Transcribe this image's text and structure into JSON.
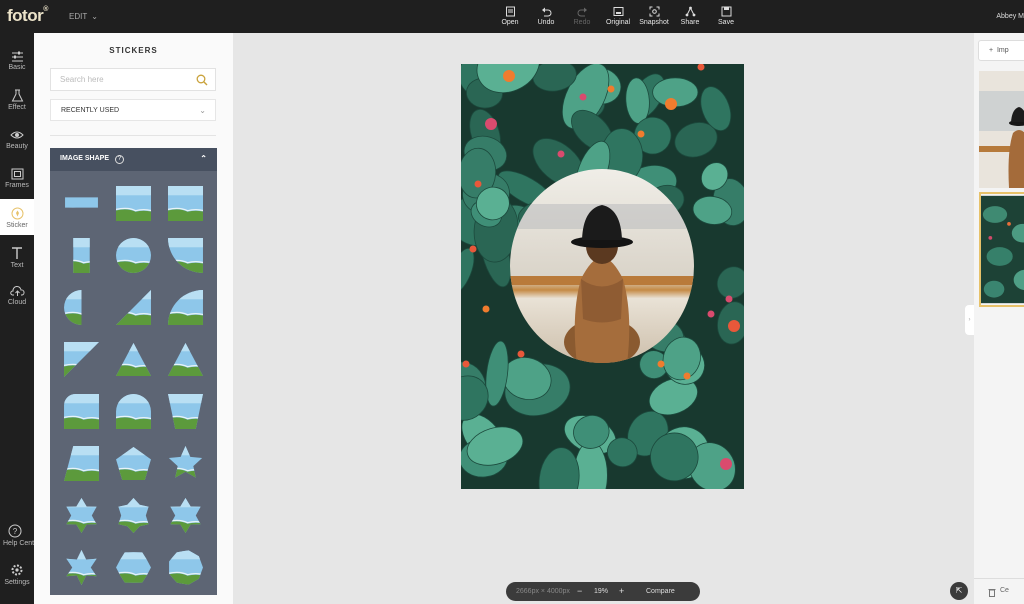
{
  "app": {
    "logo": "fotor",
    "mode": "EDIT",
    "user": "Abbey M"
  },
  "toolbar": [
    {
      "label": "Open",
      "icon": "open-icon"
    },
    {
      "label": "Undo",
      "icon": "undo-icon"
    },
    {
      "label": "Redo",
      "icon": "redo-icon"
    },
    {
      "label": "Original",
      "icon": "original-icon"
    },
    {
      "label": "Snapshot",
      "icon": "snapshot-icon"
    },
    {
      "label": "Share",
      "icon": "share-icon"
    },
    {
      "label": "Save",
      "icon": "save-icon"
    }
  ],
  "nav": {
    "basic": "Basic",
    "effect": "Effect",
    "beauty": "Beauty",
    "frames": "Frames",
    "sticker": "Sticker",
    "text": "Text",
    "cloud": "Cloud",
    "help": "Help Center",
    "settings": "Settings"
  },
  "panel": {
    "title": "STICKERS",
    "search_placeholder": "Search here",
    "category": "RECENTLY USED",
    "section": "IMAGE SHAPE",
    "help_glyph": "?"
  },
  "canvas": {
    "dimensions": "2666px × 4000px",
    "zoom": "19%",
    "minus": "−",
    "plus": "+",
    "compare": "Compare"
  },
  "right": {
    "import": "Imp",
    "clear": "Ce"
  },
  "colors": {
    "accent": "#e7c26a",
    "panel": "#5d6574",
    "dark": "#1f1f1f"
  }
}
